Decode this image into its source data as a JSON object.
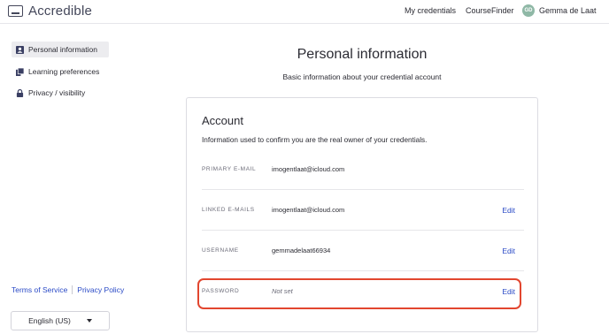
{
  "header": {
    "logo_text": "Accredible",
    "nav": {
      "my_credentials": "My credentials",
      "course_finder": "CourseFinder"
    },
    "user": {
      "initials": "GD",
      "name": "Gemma de Laat"
    }
  },
  "sidebar": {
    "items": [
      {
        "label": "Personal information",
        "icon": "person-card-icon",
        "active": true
      },
      {
        "label": "Learning preferences",
        "icon": "books-icon",
        "active": false
      },
      {
        "label": "Privacy / visibility",
        "icon": "lock-icon",
        "active": false
      }
    ],
    "footer": {
      "terms": "Terms of Service",
      "privacy": "Privacy Policy"
    },
    "language": "English (US)"
  },
  "main": {
    "title": "Personal information",
    "subtitle": "Basic information about your credential account",
    "card": {
      "title": "Account",
      "description": "Information used to confirm you are the real owner of your credentials.",
      "rows": [
        {
          "label": "PRIMARY E-MAIL",
          "value": "imogentlaat@icloud.com",
          "edit": ""
        },
        {
          "label": "LINKED E-MAILS",
          "value": "imogentlaat@icloud.com",
          "edit": "Edit"
        },
        {
          "label": "USERNAME",
          "value": "gemmadelaat66934",
          "edit": "Edit"
        },
        {
          "label": "PASSWORD",
          "value": "Not set",
          "edit": "Edit"
        }
      ]
    }
  },
  "colors": {
    "link": "#2a4ac6",
    "highlight": "#e2462f",
    "active_bg": "#ececef",
    "avatar": "#8fb8a6"
  }
}
